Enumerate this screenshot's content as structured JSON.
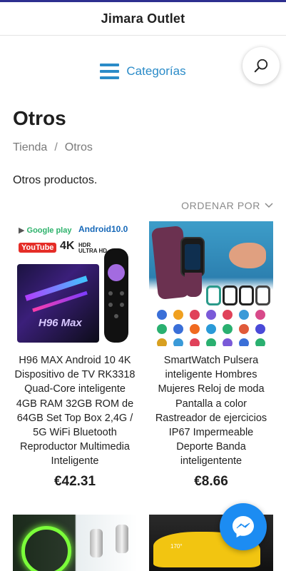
{
  "header": {
    "brand": "Jimara Outlet"
  },
  "nav": {
    "categories_label": "Categorías",
    "search_icon": "search-icon",
    "menu_icon": "hamburger-icon"
  },
  "page": {
    "title": "Otros",
    "breadcrumb": [
      "Tienda",
      "Otros"
    ],
    "breadcrumb_separator": "/",
    "description": "Otros productos.",
    "sort_label": "ORDENAR POR"
  },
  "products": [
    {
      "name": "H96 MAX Android 10 4K Dispositivo de TV RK3318 Quad-Core inteligente 4GB RAM 32GB ROM de 64GB Set Top Box 2,4G / 5G WiFi Bluetooth Reproductor Multimedia Inteligente",
      "price": "€42.31",
      "image_text": {
        "google_play": "Google play",
        "android": "Android10.0",
        "youtube": "YouTube",
        "resolution": "4K",
        "hdr": "HDR",
        "hdr_sub": "ULTRA HD",
        "box_logo": "H96 Max"
      }
    },
    {
      "name": "SmartWatch Pulsera inteligente Hombres Mujeres Reloj de moda Pantalla a color Rastreador de ejercicios IP67 Impermeable Deporte Banda inteligentente",
      "price": "€8.66"
    },
    {
      "name": "",
      "price": ""
    },
    {
      "name": "",
      "price": ""
    }
  ],
  "fab": {
    "icon": "messenger-icon"
  },
  "colors": {
    "accent": "#2a8bc8",
    "top_line": "#2d2f8f",
    "messenger": "#1c8cf2"
  }
}
